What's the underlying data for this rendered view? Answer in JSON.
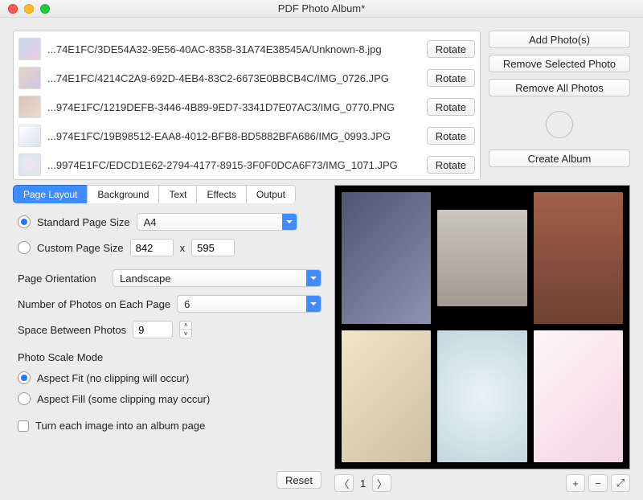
{
  "window": {
    "title": "PDF Photo Album*"
  },
  "photos": [
    {
      "name": "...74E1FC/3DE54A32-9E56-40AC-8358-31A74E38545A/Unknown-8.jpg",
      "rotate": "Rotate"
    },
    {
      "name": "...74E1FC/4214C2A9-692D-4EB4-83C2-6673E0BBCB4C/IMG_0726.JPG",
      "rotate": "Rotate"
    },
    {
      "name": "...974E1FC/1219DEFB-3446-4B89-9ED7-3341D7E07AC3/IMG_0770.PNG",
      "rotate": "Rotate"
    },
    {
      "name": "...974E1FC/19B98512-EAA8-4012-BFB8-BD5882BFA686/IMG_0993.JPG",
      "rotate": "Rotate"
    },
    {
      "name": "...9974E1FC/EDCD1E62-2794-4177-8915-3F0F0DCA6F73/IMG_1071.JPG",
      "rotate": "Rotate"
    }
  ],
  "side": {
    "add": "Add Photo(s)",
    "removeSelected": "Remove Selected Photo",
    "removeAll": "Remove All Photos",
    "create": "Create Album"
  },
  "tabs": [
    "Page Layout",
    "Background",
    "Text",
    "Effects",
    "Output"
  ],
  "form": {
    "standardLabel": "Standard Page Size",
    "standardValue": "A4",
    "customLabel": "Custom Page Size",
    "customW": "842",
    "customX": "x",
    "customH": "595",
    "orientationLabel": "Page Orientation",
    "orientationValue": "Landscape",
    "numLabel": "Number of Photos on Each Page",
    "numValue": "6",
    "spaceLabel": "Space Between Photos",
    "spaceValue": "9",
    "scaleTitle": "Photo Scale Mode",
    "aspectFit": "Aspect Fit (no clipping will occur)",
    "aspectFill": "Aspect Fill (some clipping may occur)",
    "albumCheck": "Turn each image into an album page",
    "reset": "Reset"
  },
  "preview": {
    "page": "1",
    "prev": "〈",
    "next": "〉",
    "plus": "+",
    "minus": "−",
    "expand": "⤢"
  }
}
